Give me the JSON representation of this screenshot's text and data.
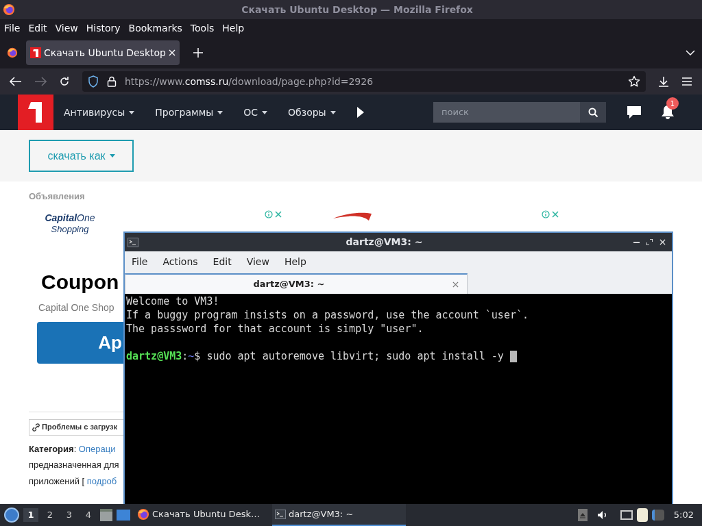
{
  "browser": {
    "title": "Скачать Ubuntu Desktop — Mozilla Firefox",
    "menu": [
      "File",
      "Edit",
      "View",
      "History",
      "Bookmarks",
      "Tools",
      "Help"
    ],
    "tabs": [
      {
        "label": "Скачать Ubuntu Desktop",
        "selected": true
      }
    ],
    "url": {
      "scheme": "https://www.",
      "domain": "comss.ru",
      "path": "/download/page.php?id=2926"
    }
  },
  "site": {
    "nav": [
      "Антивирусы",
      "Программы",
      "ОС",
      "Обзоры"
    ],
    "search": {
      "placeholder": "поиск"
    },
    "notifications": "1",
    "download_button": "скачать как",
    "ads_heading": "Объявления",
    "ad": {
      "logo_main": "Capital",
      "logo_second": "One",
      "logo_sub": "Shopping",
      "headline": "Coupon",
      "subtitle": "Capital One Shop",
      "button": "Ap"
    },
    "problems_link": "Проблемы с загрузк",
    "category_label": "Категория",
    "category_sep": ": ",
    "category_link": "Операци",
    "line_2": "предназначенная для",
    "line_3": "приложений [ ",
    "more_link": "подроб"
  },
  "terminal": {
    "title": "dartz@VM3: ~",
    "menu": [
      "File",
      "Actions",
      "Edit",
      "View",
      "Help"
    ],
    "tabs": [
      {
        "label": "dartz@VM3: ~",
        "selected": true
      }
    ],
    "lines": [
      {
        "kind": "text",
        "text": "Welcome to VM3!"
      },
      {
        "kind": "text",
        "text": "If a buggy program insists on a password, use the account `user`."
      },
      {
        "kind": "text",
        "text": "The passsword for that account is simply \"user\"."
      },
      {
        "kind": "blank"
      },
      {
        "kind": "prompt",
        "user": "dartz@VM3",
        "sep": ":",
        "path": "~",
        "sign": "$",
        "command": "sudo apt autoremove libvirt; sudo apt install -y"
      }
    ]
  },
  "taskbar": {
    "workspaces": [
      {
        "label": "1",
        "selected": true
      },
      {
        "label": "2",
        "selected": false
      },
      {
        "label": "3",
        "selected": false
      },
      {
        "label": "4",
        "selected": false
      }
    ],
    "tasks": [
      {
        "kind": "browser",
        "label": "Скачать Ubuntu Desk…",
        "selected": false
      },
      {
        "kind": "terminal",
        "label": "dartz@VM3: ~",
        "selected": true
      }
    ],
    "clock": "5:02"
  }
}
